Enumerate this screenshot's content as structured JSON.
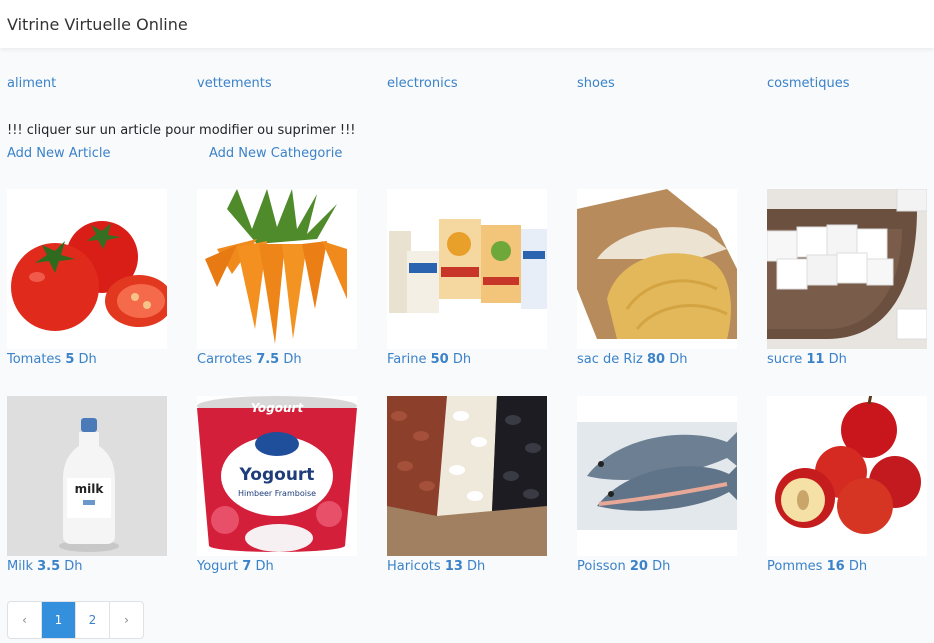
{
  "app": {
    "title": "Vitrine Virtuelle Online"
  },
  "categories": [
    "aliment",
    "vettements",
    "electronics",
    "shoes",
    "cosmetiques"
  ],
  "notice": "!!! cliquer sur un article pour modifier ou suprimer !!!",
  "actions": {
    "add_article": "Add New Article",
    "add_category": "Add New Cathegorie"
  },
  "currency": "Dh",
  "products": [
    {
      "name": "Tomates",
      "price": "5",
      "icon": "tomato"
    },
    {
      "name": "Carrotes",
      "price": "7.5",
      "icon": "carrot"
    },
    {
      "name": "Farine",
      "price": "50",
      "icon": "flour-bags"
    },
    {
      "name": "sac de Riz",
      "price": "80",
      "icon": "rice-sack"
    },
    {
      "name": "sucre",
      "price": "11",
      "icon": "sugar-cubes"
    },
    {
      "name": "Milk",
      "price": "3.5",
      "icon": "milk-bottle"
    },
    {
      "name": "Yogurt",
      "price": "7",
      "icon": "yogurt-cup"
    },
    {
      "name": "Haricots",
      "price": "13",
      "icon": "beans"
    },
    {
      "name": "Poisson",
      "price": "20",
      "icon": "fish"
    },
    {
      "name": "Pommes",
      "price": "16",
      "icon": "apples"
    }
  ],
  "image_text": {
    "milk": "milk",
    "yogurt_brand": "Yogourt",
    "yogurt_label": "Yogourt",
    "yogurt_sub": "Himbeer Framboise"
  },
  "pagination": {
    "prev": "‹",
    "pages": [
      "1",
      "2"
    ],
    "current": "1",
    "next": "›"
  }
}
